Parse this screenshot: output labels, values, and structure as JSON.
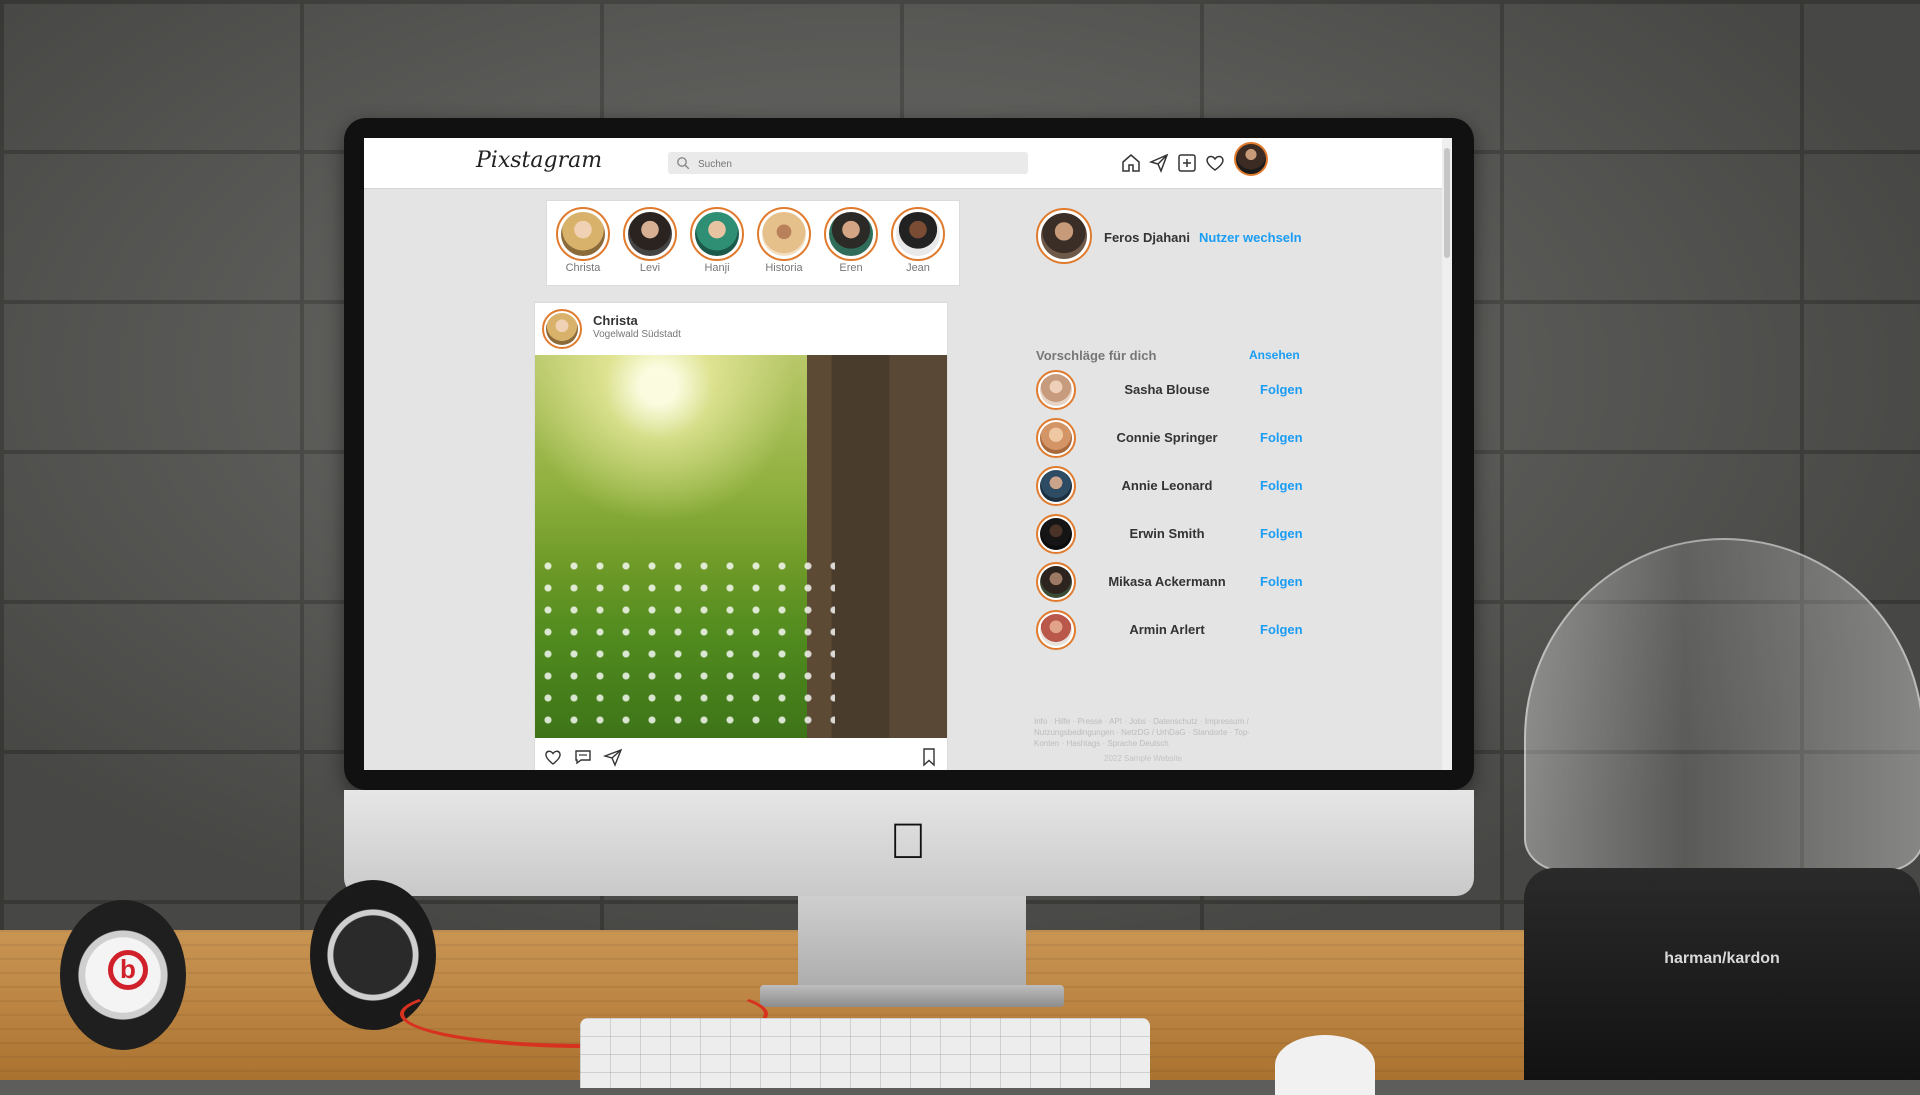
{
  "app": {
    "title": "Pixstagram",
    "search_placeholder": "Suchen"
  },
  "nav": {
    "icons": [
      "home-icon",
      "send-icon",
      "add-post-icon",
      "heart-icon"
    ]
  },
  "stories": [
    {
      "name": "Christa"
    },
    {
      "name": "Levi"
    },
    {
      "name": "Hanji"
    },
    {
      "name": "Historia"
    },
    {
      "name": "Eren"
    },
    {
      "name": "Jean"
    }
  ],
  "post": {
    "user": "Christa",
    "location": "Vogelwald Südstadt"
  },
  "profile": {
    "name": "Feros Djahani",
    "switch_label": "Nutzer wechseln"
  },
  "suggestions": {
    "title": "Vorschläge für dich",
    "view_all": "Ansehen",
    "follow_label": "Folgen",
    "items": [
      {
        "name": "Sasha Blouse"
      },
      {
        "name": "Connie Springer"
      },
      {
        "name": "Annie Leonard"
      },
      {
        "name": "Erwin Smith"
      },
      {
        "name": "Mikasa Ackermann"
      },
      {
        "name": "Armin Arlert"
      }
    ]
  },
  "footer": {
    "links": "Info · Hilfe · Presse · API · Jobs · Datenschutz · Impressum / Nutzungsbedingungen · NetzDG / UrhDaG · Standorte · Top-Konten · Hashtags · Sprache Deutsch",
    "copyright": "2022 Sample Website"
  },
  "colors": {
    "accent": "#e07b2e",
    "link": "#1a9df5",
    "page_bg": "#e4e4e4"
  },
  "brand": {
    "speaker": "harman/kardon"
  }
}
